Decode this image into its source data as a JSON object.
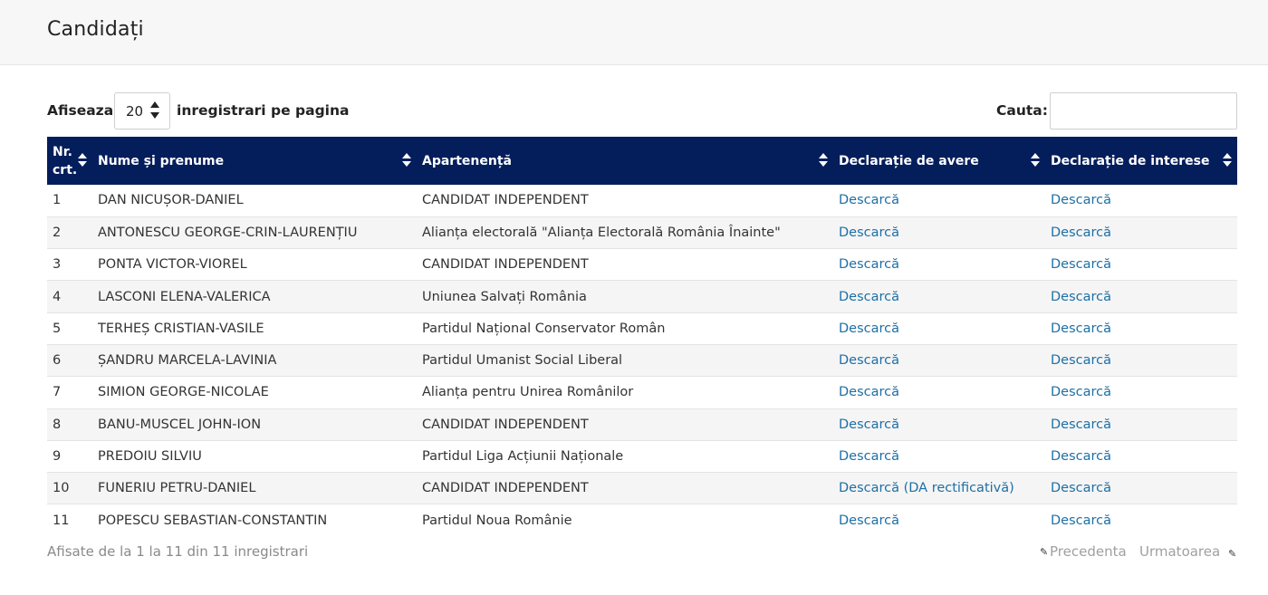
{
  "page": {
    "title": "Candidați"
  },
  "controls": {
    "show_label": "Afiseaza",
    "page_size": "20",
    "per_page_label": "inregistrari pe pagina",
    "search_label": "Cauta:",
    "search_value": ""
  },
  "table": {
    "columns": [
      {
        "line1": "Nr.",
        "line2": "crt."
      },
      {
        "label": "Nume și prenume"
      },
      {
        "label": "Apartenență"
      },
      {
        "label": "Declarație de avere"
      },
      {
        "label": "Declarație de interese"
      }
    ],
    "rows": [
      {
        "nr": "1",
        "name": "DAN NICUȘOR-DANIEL",
        "party": "CANDIDAT INDEPENDENT",
        "avere": "Descarcă",
        "interese": "Descarcă"
      },
      {
        "nr": "2",
        "name": "ANTONESCU GEORGE-CRIN-LAURENȚIU",
        "party": "Alianța electorală \"Alianța Electorală România Înainte\"",
        "avere": "Descarcă",
        "interese": "Descarcă"
      },
      {
        "nr": "3",
        "name": "PONTA VICTOR-VIOREL",
        "party": "CANDIDAT INDEPENDENT",
        "avere": "Descarcă",
        "interese": "Descarcă"
      },
      {
        "nr": "4",
        "name": "LASCONI ELENA-VALERICA",
        "party": "Uniunea Salvați România",
        "avere": "Descarcă",
        "interese": "Descarcă"
      },
      {
        "nr": "5",
        "name": "TERHEȘ CRISTIAN-VASILE",
        "party": "Partidul Național Conservator Român",
        "avere": "Descarcă",
        "interese": "Descarcă"
      },
      {
        "nr": "6",
        "name": "ȘANDRU MARCELA-LAVINIA",
        "party": "Partidul Umanist Social Liberal",
        "avere": "Descarcă",
        "interese": "Descarcă"
      },
      {
        "nr": "7",
        "name": "SIMION GEORGE-NICOLAE",
        "party": "Alianța pentru Unirea Românilor",
        "avere": "Descarcă",
        "interese": "Descarcă"
      },
      {
        "nr": "8",
        "name": "BANU-MUSCEL JOHN-ION",
        "party": "CANDIDAT INDEPENDENT",
        "avere": "Descarcă",
        "interese": "Descarcă"
      },
      {
        "nr": "9",
        "name": "PREDOIU SILVIU",
        "party": "Partidul Liga Acțiunii Naționale",
        "avere": "Descarcă",
        "interese": "Descarcă"
      },
      {
        "nr": "10",
        "name": "FUNERIU PETRU-DANIEL",
        "party": "CANDIDAT INDEPENDENT",
        "avere": "Descarcă (DA rectificativă)",
        "interese": "Descarcă"
      },
      {
        "nr": "11",
        "name": "POPESCU SEBASTIAN-CONSTANTIN",
        "party": "Partidul Noua Românie",
        "avere": "Descarcă",
        "interese": "Descarcă"
      }
    ]
  },
  "footer": {
    "info": "Afisate de la 1 la 11 din 11 inregistrari",
    "prev": "Precedenta",
    "next": "Urmatoarea",
    "prev_icon": "pencil-icon",
    "next_icon": "pencil-icon"
  },
  "colors": {
    "header_bg": "#041e5c",
    "link": "#1d6fa5"
  }
}
